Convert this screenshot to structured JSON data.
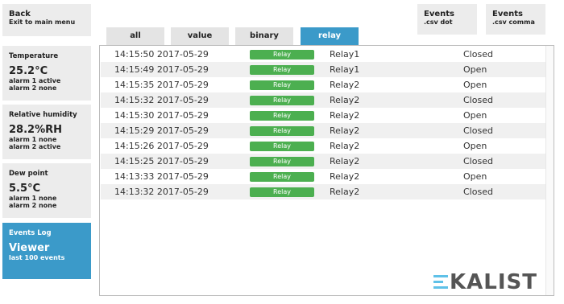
{
  "back": {
    "title": "Back",
    "subtitle": "Exit to main menu"
  },
  "export": {
    "dot": {
      "title": "Events",
      "subtitle": ".csv dot"
    },
    "comma": {
      "title": "Events",
      "subtitle": ".csv comma"
    }
  },
  "sidebar": [
    {
      "label": "Temperature",
      "value": "25.2°C",
      "alarm1": "alarm 1 active",
      "alarm2": "alarm 2 none"
    },
    {
      "label": "Relative humidity",
      "value": "28.2%RH",
      "alarm1": "alarm 1 none",
      "alarm2": "alarm 2 active"
    },
    {
      "label": "Dew point",
      "value": "5.5°C",
      "alarm1": "alarm 1 none",
      "alarm2": "alarm 2 none"
    },
    {
      "label": "Events Log",
      "value": "Viewer",
      "alarm1": "last 100 events"
    }
  ],
  "tabs": [
    "all",
    "value",
    "binary",
    "relay"
  ],
  "active_tab": "relay",
  "events": [
    {
      "time": "14:15:50 2017-05-29",
      "type": "Relay",
      "source": "Relay1",
      "state": "Closed"
    },
    {
      "time": "14:15:49 2017-05-29",
      "type": "Relay",
      "source": "Relay1",
      "state": "Open"
    },
    {
      "time": "14:15:35 2017-05-29",
      "type": "Relay",
      "source": "Relay2",
      "state": "Open"
    },
    {
      "time": "14:15:32 2017-05-29",
      "type": "Relay",
      "source": "Relay2",
      "state": "Closed"
    },
    {
      "time": "14:15:30 2017-05-29",
      "type": "Relay",
      "source": "Relay2",
      "state": "Open"
    },
    {
      "time": "14:15:29 2017-05-29",
      "type": "Relay",
      "source": "Relay2",
      "state": "Closed"
    },
    {
      "time": "14:15:26 2017-05-29",
      "type": "Relay",
      "source": "Relay2",
      "state": "Open"
    },
    {
      "time": "14:15:25 2017-05-29",
      "type": "Relay",
      "source": "Relay2",
      "state": "Closed"
    },
    {
      "time": "14:13:33 2017-05-29",
      "type": "Relay",
      "source": "Relay2",
      "state": "Open"
    },
    {
      "time": "14:13:32 2017-05-29",
      "type": "Relay",
      "source": "Relay2",
      "state": "Closed"
    }
  ],
  "brand": {
    "name": "KALIST",
    "accent": "#5fc1e8",
    "active_color": "#3b9ac9",
    "pill_color": "#4caf50"
  }
}
